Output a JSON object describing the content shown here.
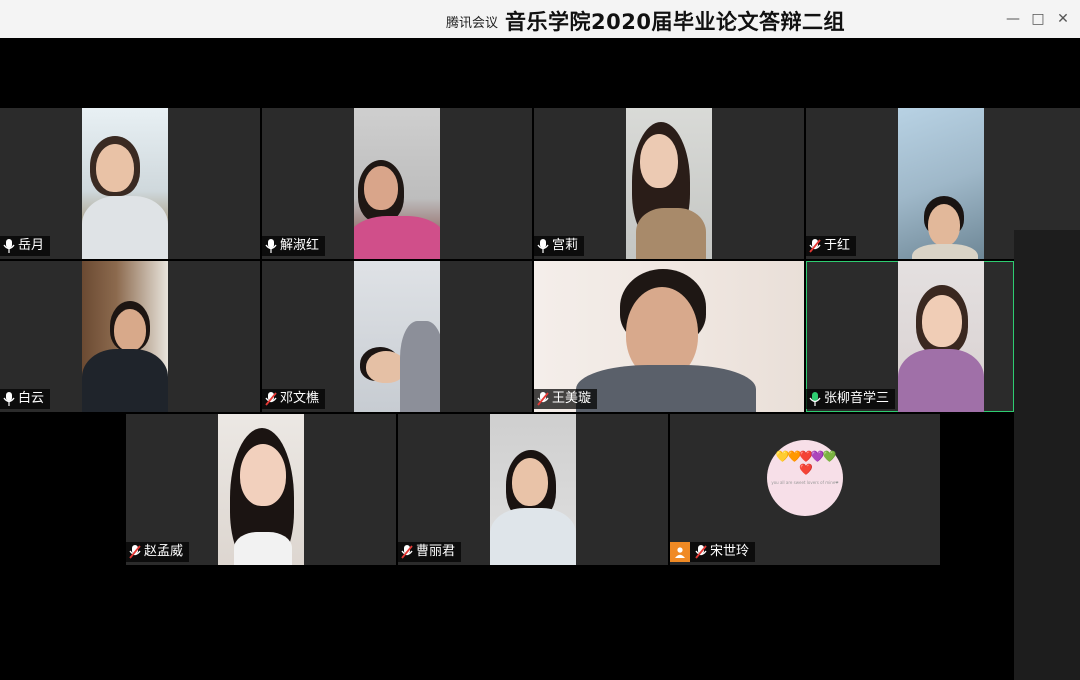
{
  "window": {
    "app_name": "腾讯会议",
    "meeting_title": "音乐学院2020届毕业论文答辩二组",
    "minimize": "—",
    "maximize": "□",
    "close": "✕"
  },
  "participants": [
    {
      "name": "岳月",
      "mic": "on"
    },
    {
      "name": "解淑红",
      "mic": "on"
    },
    {
      "name": "宫莉",
      "mic": "on"
    },
    {
      "name": "于红",
      "mic": "muted"
    },
    {
      "name": "白云",
      "mic": "on"
    },
    {
      "name": "邓文樵",
      "mic": "muted"
    },
    {
      "name": "王美璇",
      "mic": "muted"
    },
    {
      "name": "张柳音学三",
      "mic": "speaking"
    },
    {
      "name": "赵孟威",
      "mic": "muted"
    },
    {
      "name": "曹丽君",
      "mic": "muted"
    },
    {
      "name": "宋世玲",
      "mic": "muted"
    }
  ],
  "avatar_tile": {
    "hearts": "💛🧡❤️💜💚❤️",
    "caption": "you all are sweet lovers of mine❤"
  },
  "colors": {
    "tile_bg": "#2b2b2b",
    "active_border": "#2ecc71",
    "muted_red": "#e53935",
    "user_icon_orange": "#f08a24"
  }
}
